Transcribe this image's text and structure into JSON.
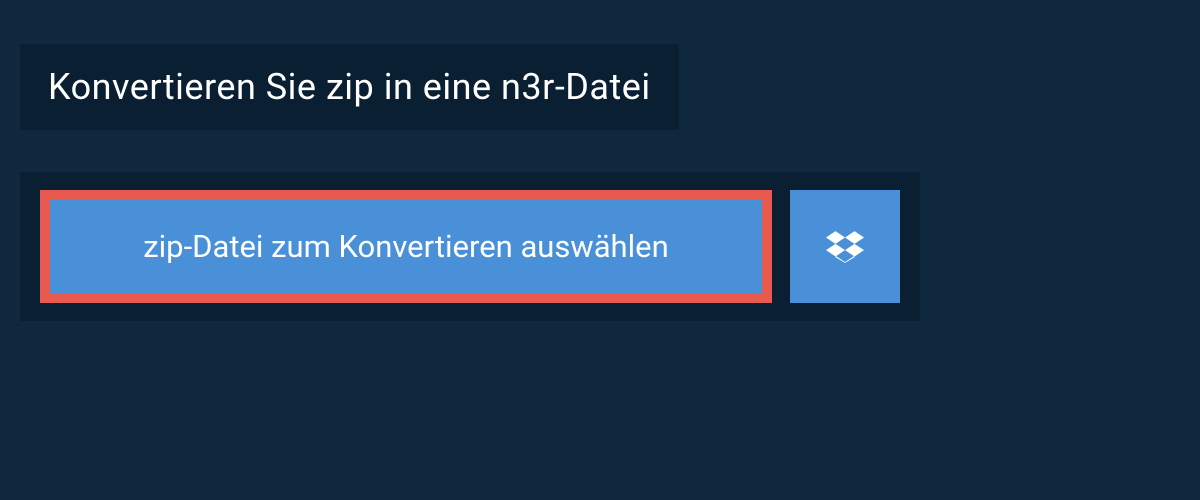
{
  "header": {
    "title": "Konvertieren Sie zip in eine n3r-Datei"
  },
  "upload": {
    "select_file_label": "zip-Datei zum Konvertieren auswählen"
  },
  "colors": {
    "bg_outer": "#10283d",
    "bg_inner": "#0a1f31",
    "button_blue": "#4a90d9",
    "highlight_border": "#e85a4f"
  }
}
